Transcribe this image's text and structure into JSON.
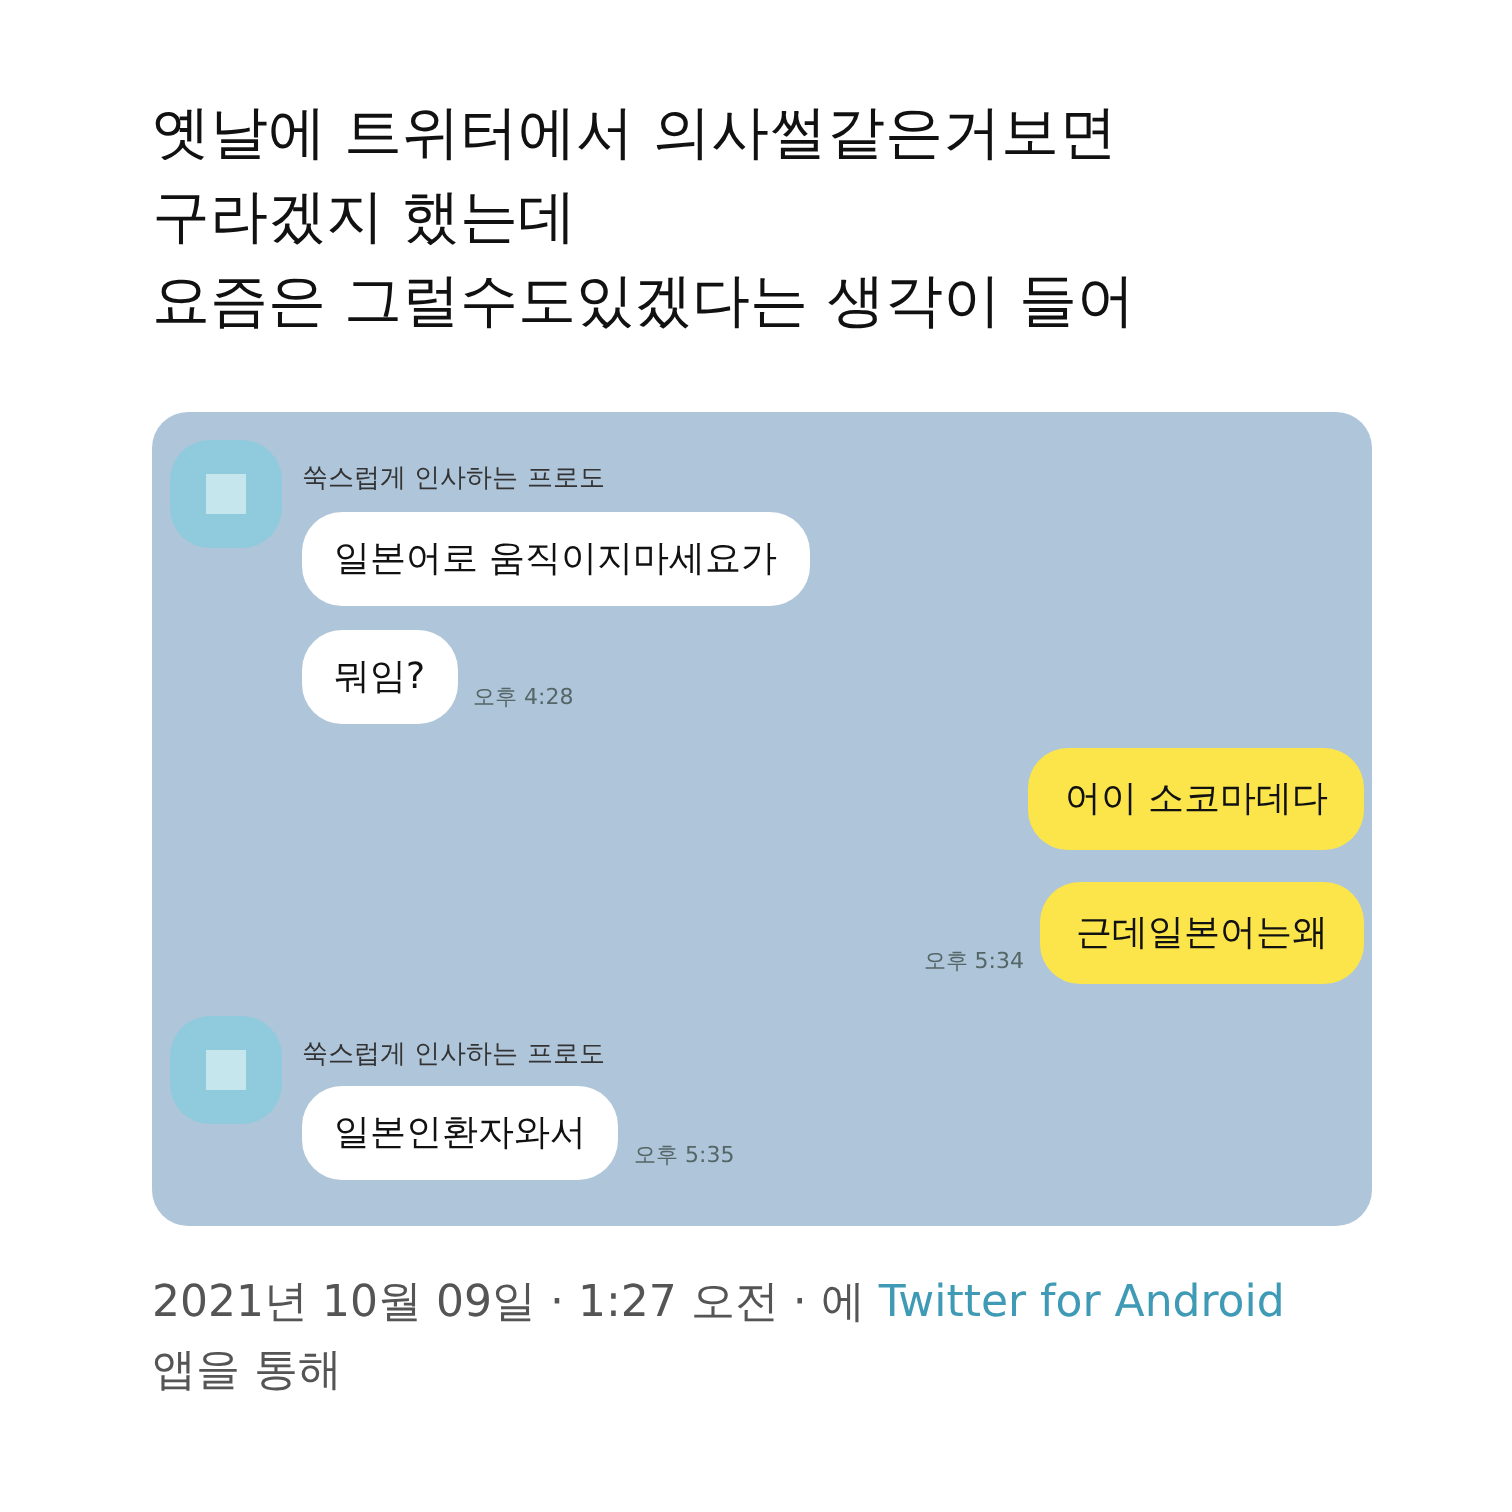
{
  "tweet_text": [
    "옛날에 트위터에서 의사썰같은거보면",
    "구라겠지 했는데",
    "요즘은 그럴수도있겠다는 생각이 들어"
  ],
  "chat": {
    "messages": [
      {
        "kind": "received",
        "sender": "쑥스럽게 인사하는 프로도",
        "bubbles": [
          "일본어로 움직이지마세요가",
          "뭐임?"
        ],
        "time": "오후 4:28"
      },
      {
        "kind": "sent",
        "bubbles": [
          "어이 소코마데다",
          "근데일본어는왜"
        ],
        "time": "오후 5:34"
      },
      {
        "kind": "received",
        "sender": "쑥스럽게 인사하는 프로도",
        "bubbles": [
          "일본인환자와서"
        ],
        "time": "오후 5:35"
      }
    ]
  },
  "footer": {
    "meta": "2021년 10월 09일 · 1:27 오전 · 에 ",
    "link": "Twitter for Android",
    "after": " 앱을 통해"
  }
}
